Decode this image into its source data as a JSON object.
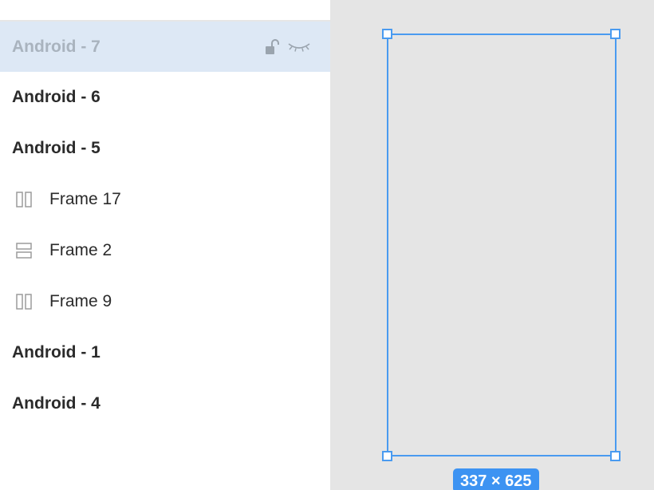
{
  "layers": [
    {
      "label": "Android - 7",
      "kind": "frame-root",
      "selected": true
    },
    {
      "label": "Android - 6",
      "kind": "frame-root"
    },
    {
      "label": "Android - 5",
      "kind": "frame-root"
    },
    {
      "label": "Frame 17",
      "kind": "frame",
      "icon": "columns-layout-icon"
    },
    {
      "label": "Frame 2",
      "kind": "frame",
      "icon": "rows-layout-icon"
    },
    {
      "label": "Frame 9",
      "kind": "frame",
      "icon": "columns-layout-icon"
    },
    {
      "label": "Android - 1",
      "kind": "frame-root"
    },
    {
      "label": "Android - 4",
      "kind": "frame-root"
    }
  ],
  "selected_row_actions": {
    "lock_icon": "unlock-icon",
    "visibility_icon": "eye-closed-icon"
  },
  "canvas": {
    "selection_dimensions": "337 × 625",
    "selection_color": "#4a9bf0",
    "badge_color": "#3d93f2",
    "background": "#e5e5e5"
  }
}
